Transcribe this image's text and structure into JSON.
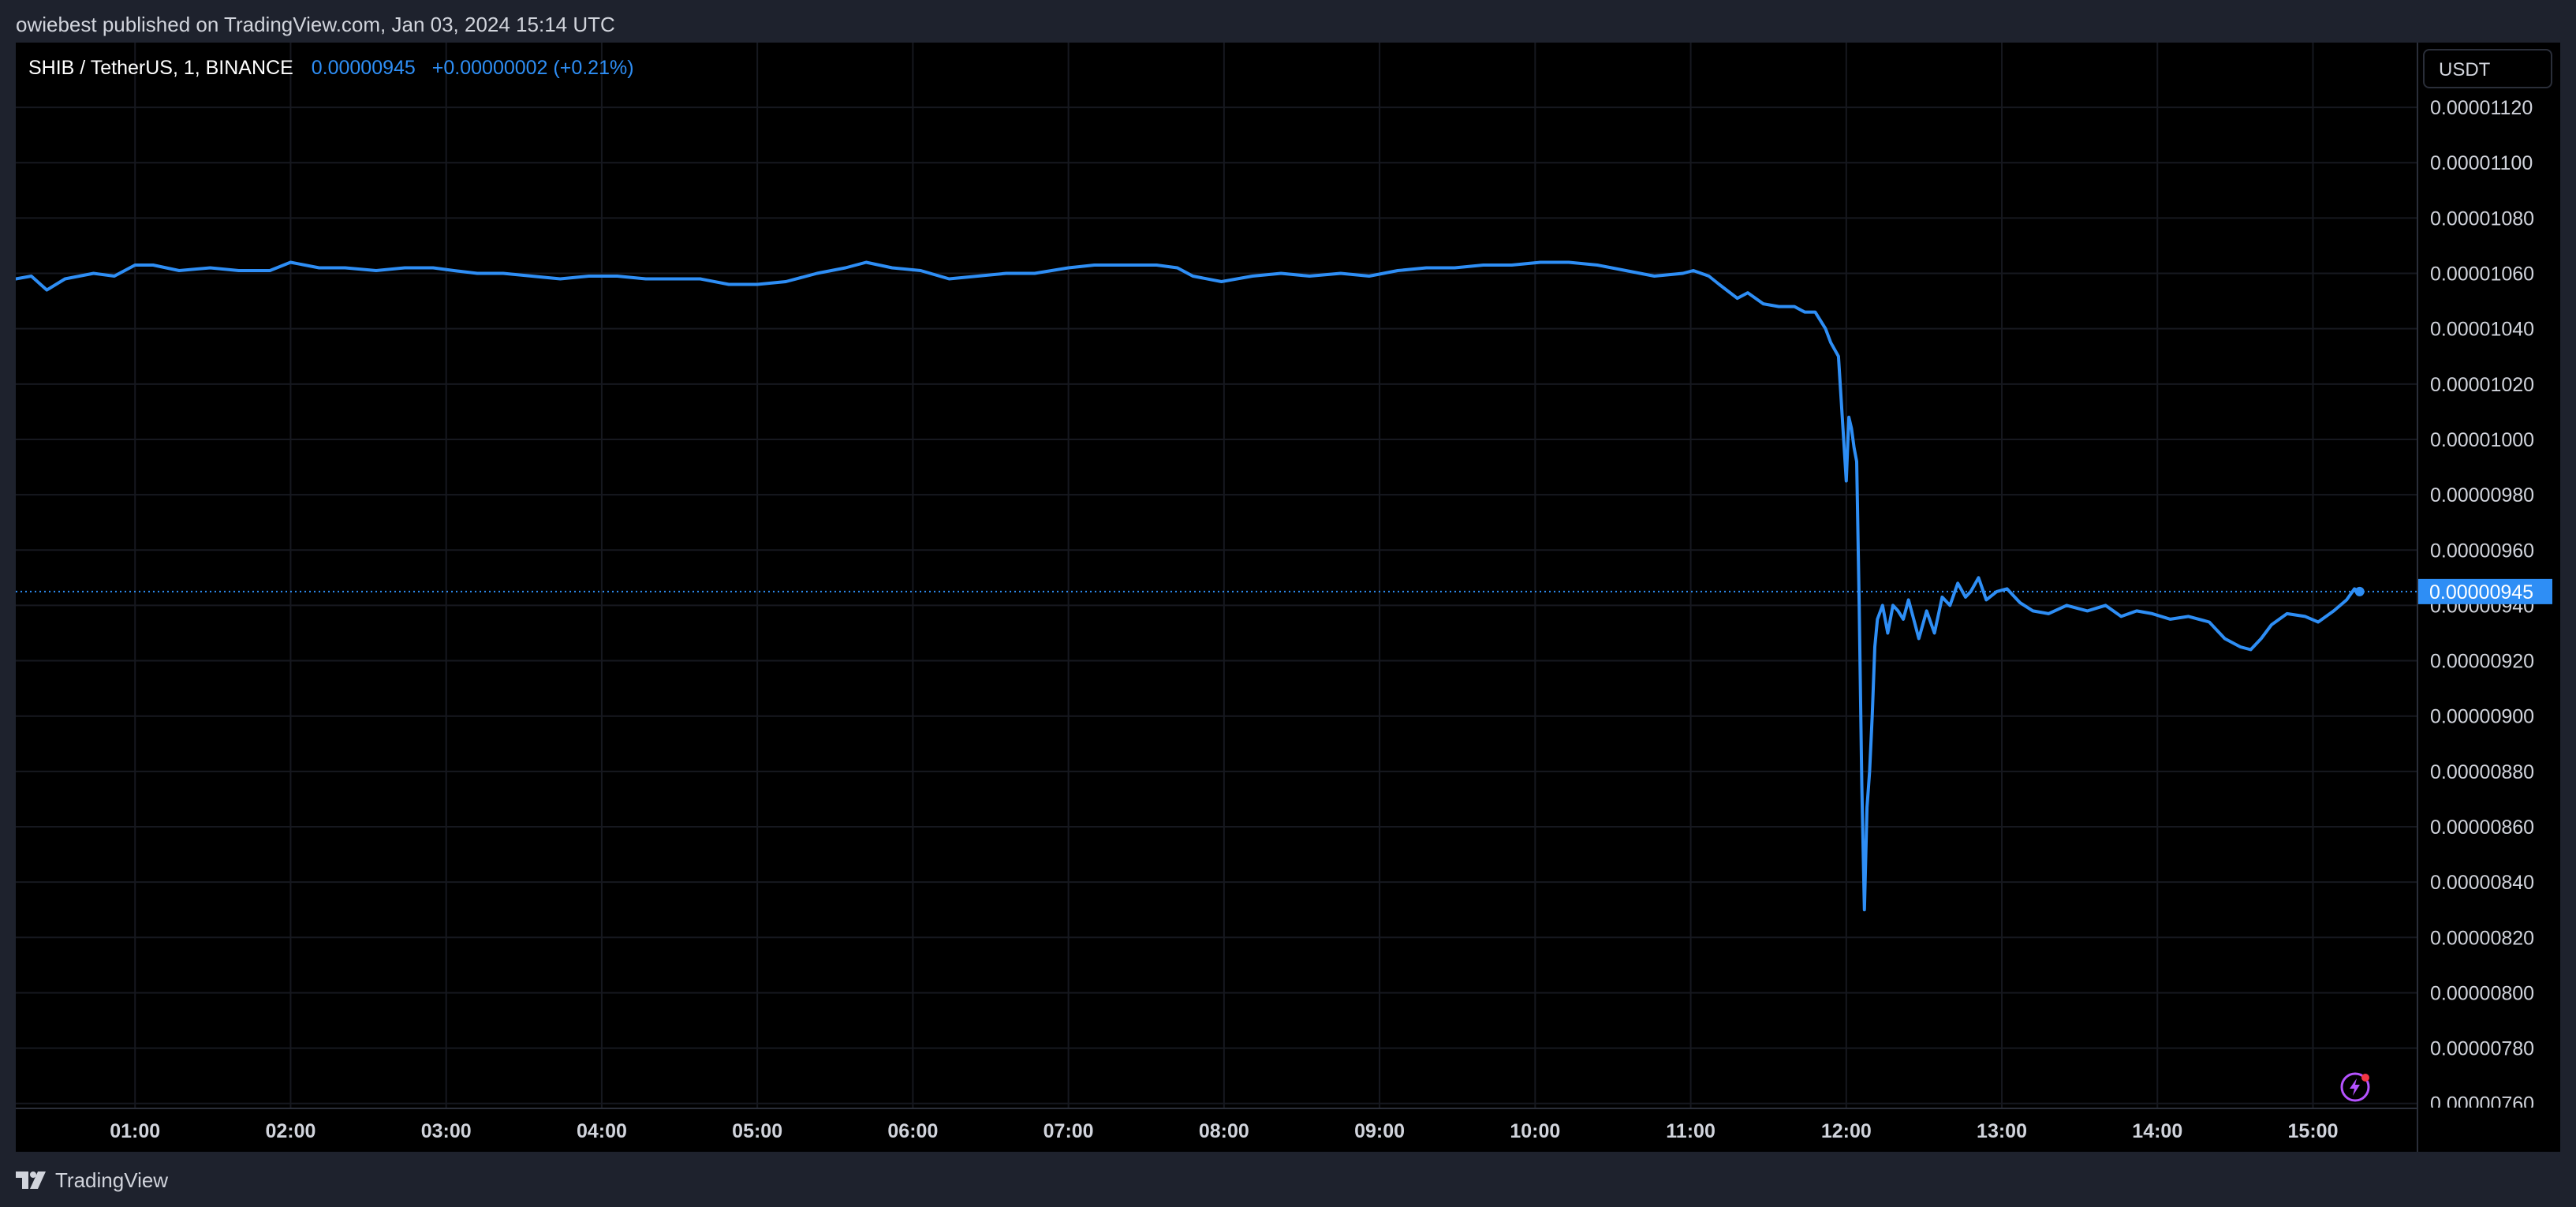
{
  "header": {
    "published": "owiebest published on TradingView.com, Jan 03, 2024 15:14 UTC"
  },
  "legend": {
    "symbol": "SHIB / TetherUS, 1, BINANCE",
    "last": "0.00000945",
    "change": "+0.00000002 (+0.21%)"
  },
  "scale": {
    "currency": "USDT"
  },
  "footer": {
    "brand": "TradingView"
  },
  "icons": {
    "logo": "tradingview-logo-icon",
    "flash": "lightning-icon"
  },
  "colors": {
    "line": "#2e8ef5",
    "background": "#000000",
    "frame": "#1e222d",
    "grid": "#16181f",
    "text": "#d1d4dc",
    "badge": "#2e8ef5",
    "flash": "#b553ff"
  },
  "chart_data": {
    "type": "line",
    "xlabel": "",
    "ylabel": "",
    "grid": true,
    "price_axis_side": "right",
    "xlim": [
      "00:14",
      "15:40"
    ],
    "ylim": [
      7.585e-06,
      1.1434e-05
    ],
    "x_ticks": [
      "01:00",
      "02:00",
      "03:00",
      "04:00",
      "05:00",
      "06:00",
      "07:00",
      "08:00",
      "09:00",
      "10:00",
      "11:00",
      "12:00",
      "13:00",
      "14:00",
      "15:00"
    ],
    "y_ticks": [
      "0.00000760",
      "0.00000780",
      "0.00000800",
      "0.00000820",
      "0.00000840",
      "0.00000860",
      "0.00000880",
      "0.00000900",
      "0.00000920",
      "0.00000940",
      "0.00000960",
      "0.00000980",
      "0.00001000",
      "0.00001020",
      "0.00001040",
      "0.00001060",
      "0.00001080",
      "0.00001100",
      "0.00001120"
    ],
    "last_price_label": "0.00000945",
    "last_price": 9.45e-06,
    "series": [
      {
        "x": [
          "00:14",
          "00:20",
          "00:26",
          "00:33",
          "00:44",
          "00:52",
          "01:00",
          "01:07",
          "01:17",
          "01:29",
          "01:40",
          "01:52",
          "02:00",
          "02:11",
          "02:21",
          "02:33",
          "02:44",
          "02:55",
          "03:03",
          "03:12",
          "03:22",
          "03:33",
          "03:44",
          "03:55",
          "04:06",
          "04:17",
          "04:28",
          "04:38",
          "04:49",
          "05:00",
          "05:11",
          "05:23",
          "05:34",
          "05:42",
          "05:52",
          "06:03",
          "06:14",
          "06:25",
          "06:36",
          "06:47",
          "07:00",
          "07:10",
          "07:23",
          "07:34",
          "07:42",
          "07:48",
          "07:59",
          "08:11",
          "08:22",
          "08:33",
          "08:45",
          "08:56",
          "09:07",
          "09:18",
          "09:29",
          "09:40",
          "09:51",
          "10:02",
          "10:13",
          "10:24",
          "10:35",
          "10:46",
          "10:57",
          "11:01",
          "11:07",
          "11:11",
          "11:18",
          "11:22",
          "11:28",
          "11:34",
          "11:40",
          "11:44",
          "11:48",
          "11:52",
          "11:54",
          "11:57",
          "12:00",
          "12:01",
          "12:02",
          "12:03",
          "12:04",
          "12:05",
          "12:06",
          "12:07",
          "12:08",
          "12:09",
          "12:10",
          "12:11",
          "12:12",
          "12:14",
          "12:16",
          "12:18",
          "12:20",
          "12:22",
          "12:24",
          "12:26",
          "12:28",
          "12:31",
          "12:34",
          "12:37",
          "12:40",
          "12:43",
          "12:46",
          "12:48",
          "12:51",
          "12:54",
          "12:58",
          "13:02",
          "13:07",
          "13:12",
          "13:18",
          "13:25",
          "13:33",
          "13:40",
          "13:46",
          "13:52",
          "13:58",
          "14:05",
          "14:12",
          "14:20",
          "14:26",
          "14:32",
          "14:36",
          "14:40",
          "14:44",
          "14:50",
          "14:57",
          "15:02",
          "15:08",
          "15:13",
          "15:16",
          "15:18"
        ],
        "y": [
          1.058e-05,
          1.059e-05,
          1.054e-05,
          1.058e-05,
          1.06e-05,
          1.059e-05,
          1.063e-05,
          1.063e-05,
          1.061e-05,
          1.062e-05,
          1.061e-05,
          1.061e-05,
          1.064e-05,
          1.062e-05,
          1.062e-05,
          1.061e-05,
          1.062e-05,
          1.062e-05,
          1.061e-05,
          1.06e-05,
          1.06e-05,
          1.059e-05,
          1.058e-05,
          1.059e-05,
          1.059e-05,
          1.058e-05,
          1.058e-05,
          1.058e-05,
          1.056e-05,
          1.056e-05,
          1.057e-05,
          1.06e-05,
          1.062e-05,
          1.064e-05,
          1.062e-05,
          1.061e-05,
          1.058e-05,
          1.059e-05,
          1.06e-05,
          1.06e-05,
          1.062e-05,
          1.063e-05,
          1.063e-05,
          1.063e-05,
          1.062e-05,
          1.059e-05,
          1.057e-05,
          1.059e-05,
          1.06e-05,
          1.059e-05,
          1.06e-05,
          1.059e-05,
          1.061e-05,
          1.062e-05,
          1.062e-05,
          1.063e-05,
          1.063e-05,
          1.064e-05,
          1.064e-05,
          1.063e-05,
          1.061e-05,
          1.059e-05,
          1.06e-05,
          1.061e-05,
          1.059e-05,
          1.056e-05,
          1.051e-05,
          1.053e-05,
          1.049e-05,
          1.048e-05,
          1.048e-05,
          1.046e-05,
          1.046e-05,
          1.04e-05,
          1.035e-05,
          1.03e-05,
          9.85e-06,
          1.008e-05,
          1.004e-05,
          9.97e-06,
          9.92e-06,
          9.4e-06,
          8.75e-06,
          8.3e-06,
          8.67e-06,
          8.8e-06,
          9e-06,
          9.25e-06,
          9.35e-06,
          9.4e-06,
          9.3e-06,
          9.4e-06,
          9.38e-06,
          9.35e-06,
          9.42e-06,
          9.35e-06,
          9.28e-06,
          9.38e-06,
          9.3e-06,
          9.43e-06,
          9.4e-06,
          9.48e-06,
          9.43e-06,
          9.45e-06,
          9.5e-06,
          9.42e-06,
          9.45e-06,
          9.46e-06,
          9.41e-06,
          9.38e-06,
          9.37e-06,
          9.4e-06,
          9.38e-06,
          9.4e-06,
          9.36e-06,
          9.38e-06,
          9.37e-06,
          9.35e-06,
          9.36e-06,
          9.34e-06,
          9.28e-06,
          9.25e-06,
          9.24e-06,
          9.28e-06,
          9.33e-06,
          9.37e-06,
          9.36e-06,
          9.34e-06,
          9.38e-06,
          9.42e-06,
          9.46e-06,
          9.45e-06
        ]
      }
    ]
  }
}
